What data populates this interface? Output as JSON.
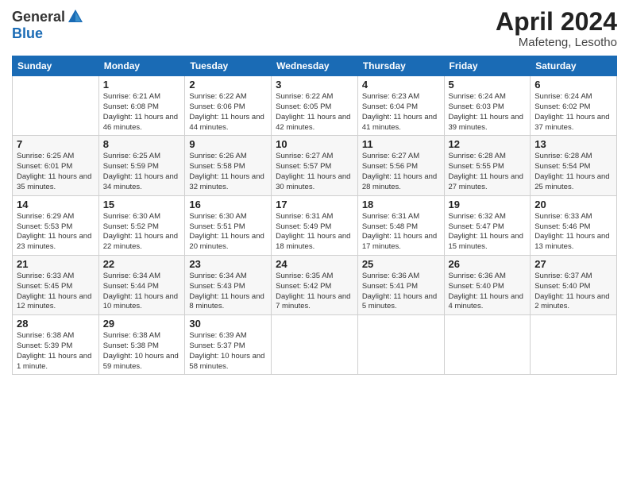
{
  "header": {
    "logo_general": "General",
    "logo_blue": "Blue",
    "month_year": "April 2024",
    "location": "Mafeteng, Lesotho"
  },
  "weekdays": [
    "Sunday",
    "Monday",
    "Tuesday",
    "Wednesday",
    "Thursday",
    "Friday",
    "Saturday"
  ],
  "weeks": [
    [
      {
        "day": "",
        "sunrise": "",
        "sunset": "",
        "daylight": ""
      },
      {
        "day": "1",
        "sunrise": "Sunrise: 6:21 AM",
        "sunset": "Sunset: 6:08 PM",
        "daylight": "Daylight: 11 hours and 46 minutes."
      },
      {
        "day": "2",
        "sunrise": "Sunrise: 6:22 AM",
        "sunset": "Sunset: 6:06 PM",
        "daylight": "Daylight: 11 hours and 44 minutes."
      },
      {
        "day": "3",
        "sunrise": "Sunrise: 6:22 AM",
        "sunset": "Sunset: 6:05 PM",
        "daylight": "Daylight: 11 hours and 42 minutes."
      },
      {
        "day": "4",
        "sunrise": "Sunrise: 6:23 AM",
        "sunset": "Sunset: 6:04 PM",
        "daylight": "Daylight: 11 hours and 41 minutes."
      },
      {
        "day": "5",
        "sunrise": "Sunrise: 6:24 AM",
        "sunset": "Sunset: 6:03 PM",
        "daylight": "Daylight: 11 hours and 39 minutes."
      },
      {
        "day": "6",
        "sunrise": "Sunrise: 6:24 AM",
        "sunset": "Sunset: 6:02 PM",
        "daylight": "Daylight: 11 hours and 37 minutes."
      }
    ],
    [
      {
        "day": "7",
        "sunrise": "Sunrise: 6:25 AM",
        "sunset": "Sunset: 6:01 PM",
        "daylight": "Daylight: 11 hours and 35 minutes."
      },
      {
        "day": "8",
        "sunrise": "Sunrise: 6:25 AM",
        "sunset": "Sunset: 5:59 PM",
        "daylight": "Daylight: 11 hours and 34 minutes."
      },
      {
        "day": "9",
        "sunrise": "Sunrise: 6:26 AM",
        "sunset": "Sunset: 5:58 PM",
        "daylight": "Daylight: 11 hours and 32 minutes."
      },
      {
        "day": "10",
        "sunrise": "Sunrise: 6:27 AM",
        "sunset": "Sunset: 5:57 PM",
        "daylight": "Daylight: 11 hours and 30 minutes."
      },
      {
        "day": "11",
        "sunrise": "Sunrise: 6:27 AM",
        "sunset": "Sunset: 5:56 PM",
        "daylight": "Daylight: 11 hours and 28 minutes."
      },
      {
        "day": "12",
        "sunrise": "Sunrise: 6:28 AM",
        "sunset": "Sunset: 5:55 PM",
        "daylight": "Daylight: 11 hours and 27 minutes."
      },
      {
        "day": "13",
        "sunrise": "Sunrise: 6:28 AM",
        "sunset": "Sunset: 5:54 PM",
        "daylight": "Daylight: 11 hours and 25 minutes."
      }
    ],
    [
      {
        "day": "14",
        "sunrise": "Sunrise: 6:29 AM",
        "sunset": "Sunset: 5:53 PM",
        "daylight": "Daylight: 11 hours and 23 minutes."
      },
      {
        "day": "15",
        "sunrise": "Sunrise: 6:30 AM",
        "sunset": "Sunset: 5:52 PM",
        "daylight": "Daylight: 11 hours and 22 minutes."
      },
      {
        "day": "16",
        "sunrise": "Sunrise: 6:30 AM",
        "sunset": "Sunset: 5:51 PM",
        "daylight": "Daylight: 11 hours and 20 minutes."
      },
      {
        "day": "17",
        "sunrise": "Sunrise: 6:31 AM",
        "sunset": "Sunset: 5:49 PM",
        "daylight": "Daylight: 11 hours and 18 minutes."
      },
      {
        "day": "18",
        "sunrise": "Sunrise: 6:31 AM",
        "sunset": "Sunset: 5:48 PM",
        "daylight": "Daylight: 11 hours and 17 minutes."
      },
      {
        "day": "19",
        "sunrise": "Sunrise: 6:32 AM",
        "sunset": "Sunset: 5:47 PM",
        "daylight": "Daylight: 11 hours and 15 minutes."
      },
      {
        "day": "20",
        "sunrise": "Sunrise: 6:33 AM",
        "sunset": "Sunset: 5:46 PM",
        "daylight": "Daylight: 11 hours and 13 minutes."
      }
    ],
    [
      {
        "day": "21",
        "sunrise": "Sunrise: 6:33 AM",
        "sunset": "Sunset: 5:45 PM",
        "daylight": "Daylight: 11 hours and 12 minutes."
      },
      {
        "day": "22",
        "sunrise": "Sunrise: 6:34 AM",
        "sunset": "Sunset: 5:44 PM",
        "daylight": "Daylight: 11 hours and 10 minutes."
      },
      {
        "day": "23",
        "sunrise": "Sunrise: 6:34 AM",
        "sunset": "Sunset: 5:43 PM",
        "daylight": "Daylight: 11 hours and 8 minutes."
      },
      {
        "day": "24",
        "sunrise": "Sunrise: 6:35 AM",
        "sunset": "Sunset: 5:42 PM",
        "daylight": "Daylight: 11 hours and 7 minutes."
      },
      {
        "day": "25",
        "sunrise": "Sunrise: 6:36 AM",
        "sunset": "Sunset: 5:41 PM",
        "daylight": "Daylight: 11 hours and 5 minutes."
      },
      {
        "day": "26",
        "sunrise": "Sunrise: 6:36 AM",
        "sunset": "Sunset: 5:40 PM",
        "daylight": "Daylight: 11 hours and 4 minutes."
      },
      {
        "day": "27",
        "sunrise": "Sunrise: 6:37 AM",
        "sunset": "Sunset: 5:40 PM",
        "daylight": "Daylight: 11 hours and 2 minutes."
      }
    ],
    [
      {
        "day": "28",
        "sunrise": "Sunrise: 6:38 AM",
        "sunset": "Sunset: 5:39 PM",
        "daylight": "Daylight: 11 hours and 1 minute."
      },
      {
        "day": "29",
        "sunrise": "Sunrise: 6:38 AM",
        "sunset": "Sunset: 5:38 PM",
        "daylight": "Daylight: 10 hours and 59 minutes."
      },
      {
        "day": "30",
        "sunrise": "Sunrise: 6:39 AM",
        "sunset": "Sunset: 5:37 PM",
        "daylight": "Daylight: 10 hours and 58 minutes."
      },
      {
        "day": "",
        "sunrise": "",
        "sunset": "",
        "daylight": ""
      },
      {
        "day": "",
        "sunrise": "",
        "sunset": "",
        "daylight": ""
      },
      {
        "day": "",
        "sunrise": "",
        "sunset": "",
        "daylight": ""
      },
      {
        "day": "",
        "sunrise": "",
        "sunset": "",
        "daylight": ""
      }
    ]
  ]
}
